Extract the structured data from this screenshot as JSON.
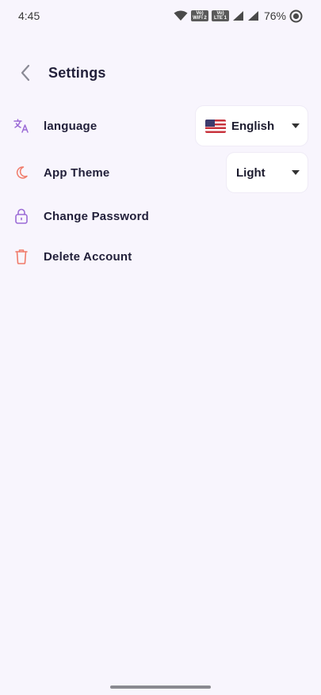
{
  "status_bar": {
    "time": "4:45",
    "battery": "76%",
    "volte1_line1": "Vo)",
    "volte1_line2": "WiFi 2",
    "volte2_line1": "Vo)",
    "volte2_line2": "LTE 1"
  },
  "header": {
    "title": "Settings"
  },
  "settings": {
    "language": {
      "label": "language",
      "selected": "English",
      "flag": "us-flag-icon"
    },
    "theme": {
      "label": "App Theme",
      "selected": "Light"
    },
    "change_password": {
      "label": "Change Password"
    },
    "delete_account": {
      "label": "Delete Account"
    }
  },
  "colors": {
    "background": "#f8f5fd",
    "purple_icon": "#9b6bd6",
    "orange_icon": "#f07b6a"
  }
}
